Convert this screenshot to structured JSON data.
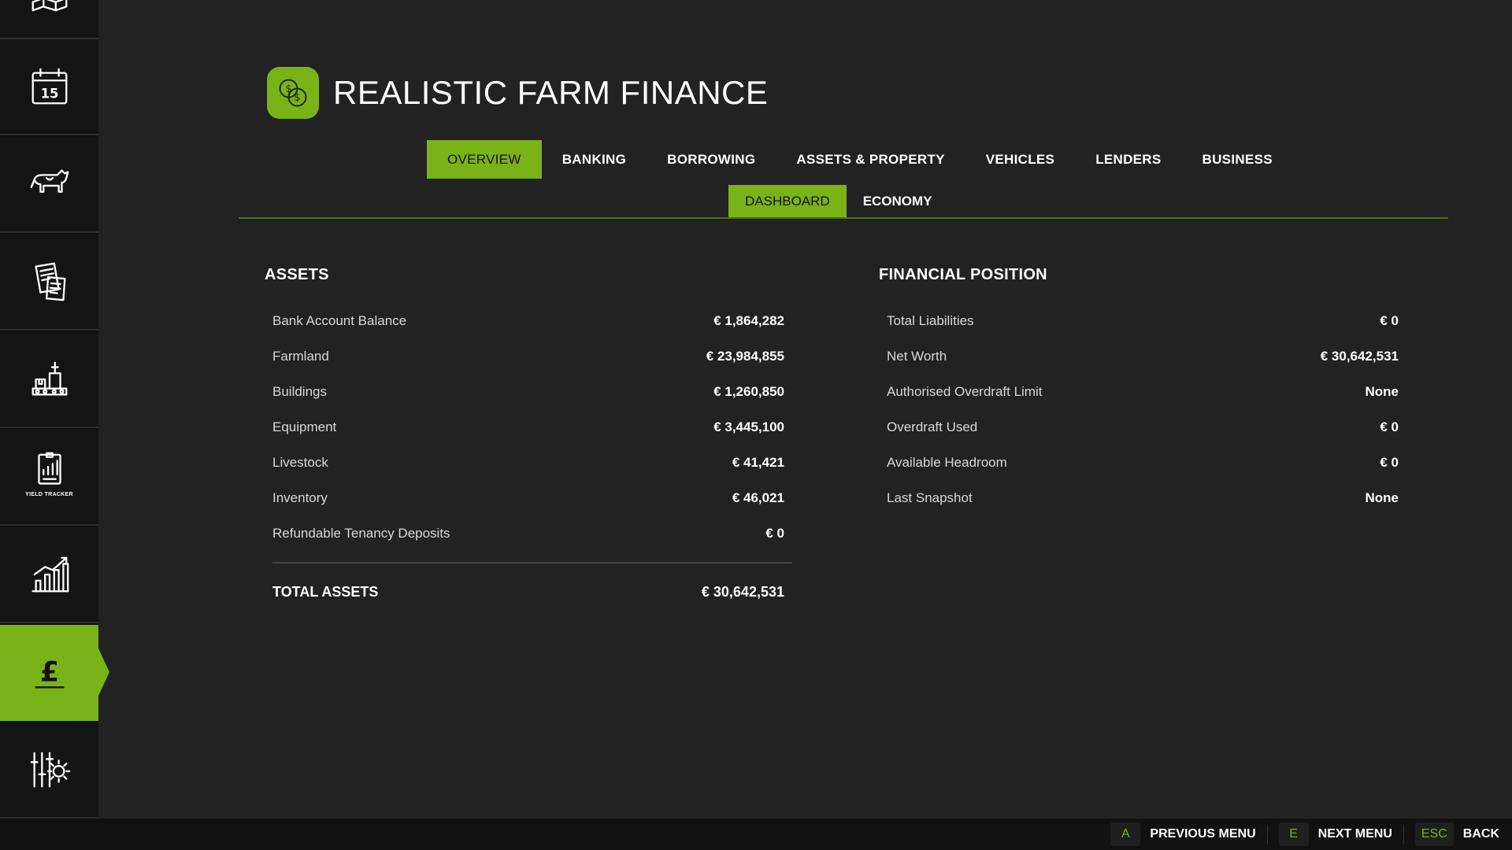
{
  "sidebar": {
    "items": [
      {
        "icon": "map-icon",
        "active": false
      },
      {
        "icon": "calendar-icon",
        "label": "15",
        "active": false
      },
      {
        "icon": "cow-icon",
        "active": false
      },
      {
        "icon": "contracts-icon",
        "active": false
      },
      {
        "icon": "production-icon",
        "active": false
      },
      {
        "icon": "yield-tracker-icon",
        "label": "YIELD TRACKER",
        "active": false
      },
      {
        "icon": "statistics-icon",
        "active": false
      },
      {
        "icon": "pound-icon",
        "label": "£",
        "active": true
      },
      {
        "icon": "settings-icon",
        "active": false
      }
    ]
  },
  "header": {
    "title": "REALISTIC FARM FINANCE"
  },
  "tabs": [
    "OVERVIEW",
    "BANKING",
    "BORROWING",
    "ASSETS & PROPERTY",
    "VEHICLES",
    "LENDERS",
    "BUSINESS"
  ],
  "subtabs": [
    "DASHBOARD",
    "ECONOMY"
  ],
  "assets": {
    "title": "ASSETS",
    "rows": [
      {
        "label": "Bank Account Balance",
        "value": "€ 1,864,282"
      },
      {
        "label": "Farmland",
        "value": "€ 23,984,855"
      },
      {
        "label": "Buildings",
        "value": "€ 1,260,850"
      },
      {
        "label": "Equipment",
        "value": "€ 3,445,100"
      },
      {
        "label": "Livestock",
        "value": "€ 41,421"
      },
      {
        "label": "Inventory",
        "value": "€ 46,021"
      },
      {
        "label": "Refundable Tenancy Deposits",
        "value": "€ 0"
      }
    ],
    "total_label": "TOTAL ASSETS",
    "total_value": "€ 30,642,531"
  },
  "financial": {
    "title": "FINANCIAL POSITION",
    "rows": [
      {
        "label": "Total Liabilities",
        "value": "€ 0"
      },
      {
        "label": "Net Worth",
        "value": "€ 30,642,531"
      },
      {
        "label": "Authorised Overdraft Limit",
        "value": "None"
      },
      {
        "label": "Overdraft Used",
        "value": "€ 0"
      },
      {
        "label": "Available Headroom",
        "value": "€ 0"
      },
      {
        "label": "Last Snapshot",
        "value": "None"
      }
    ]
  },
  "footer": {
    "prev_key": "A",
    "prev_label": "PREVIOUS MENU",
    "next_key": "E",
    "next_label": "NEXT MENU",
    "back_key": "ESC",
    "back_label": "BACK"
  },
  "colors": {
    "accent": "#7ab317",
    "background": "#222222",
    "sidebar": "#141414"
  }
}
